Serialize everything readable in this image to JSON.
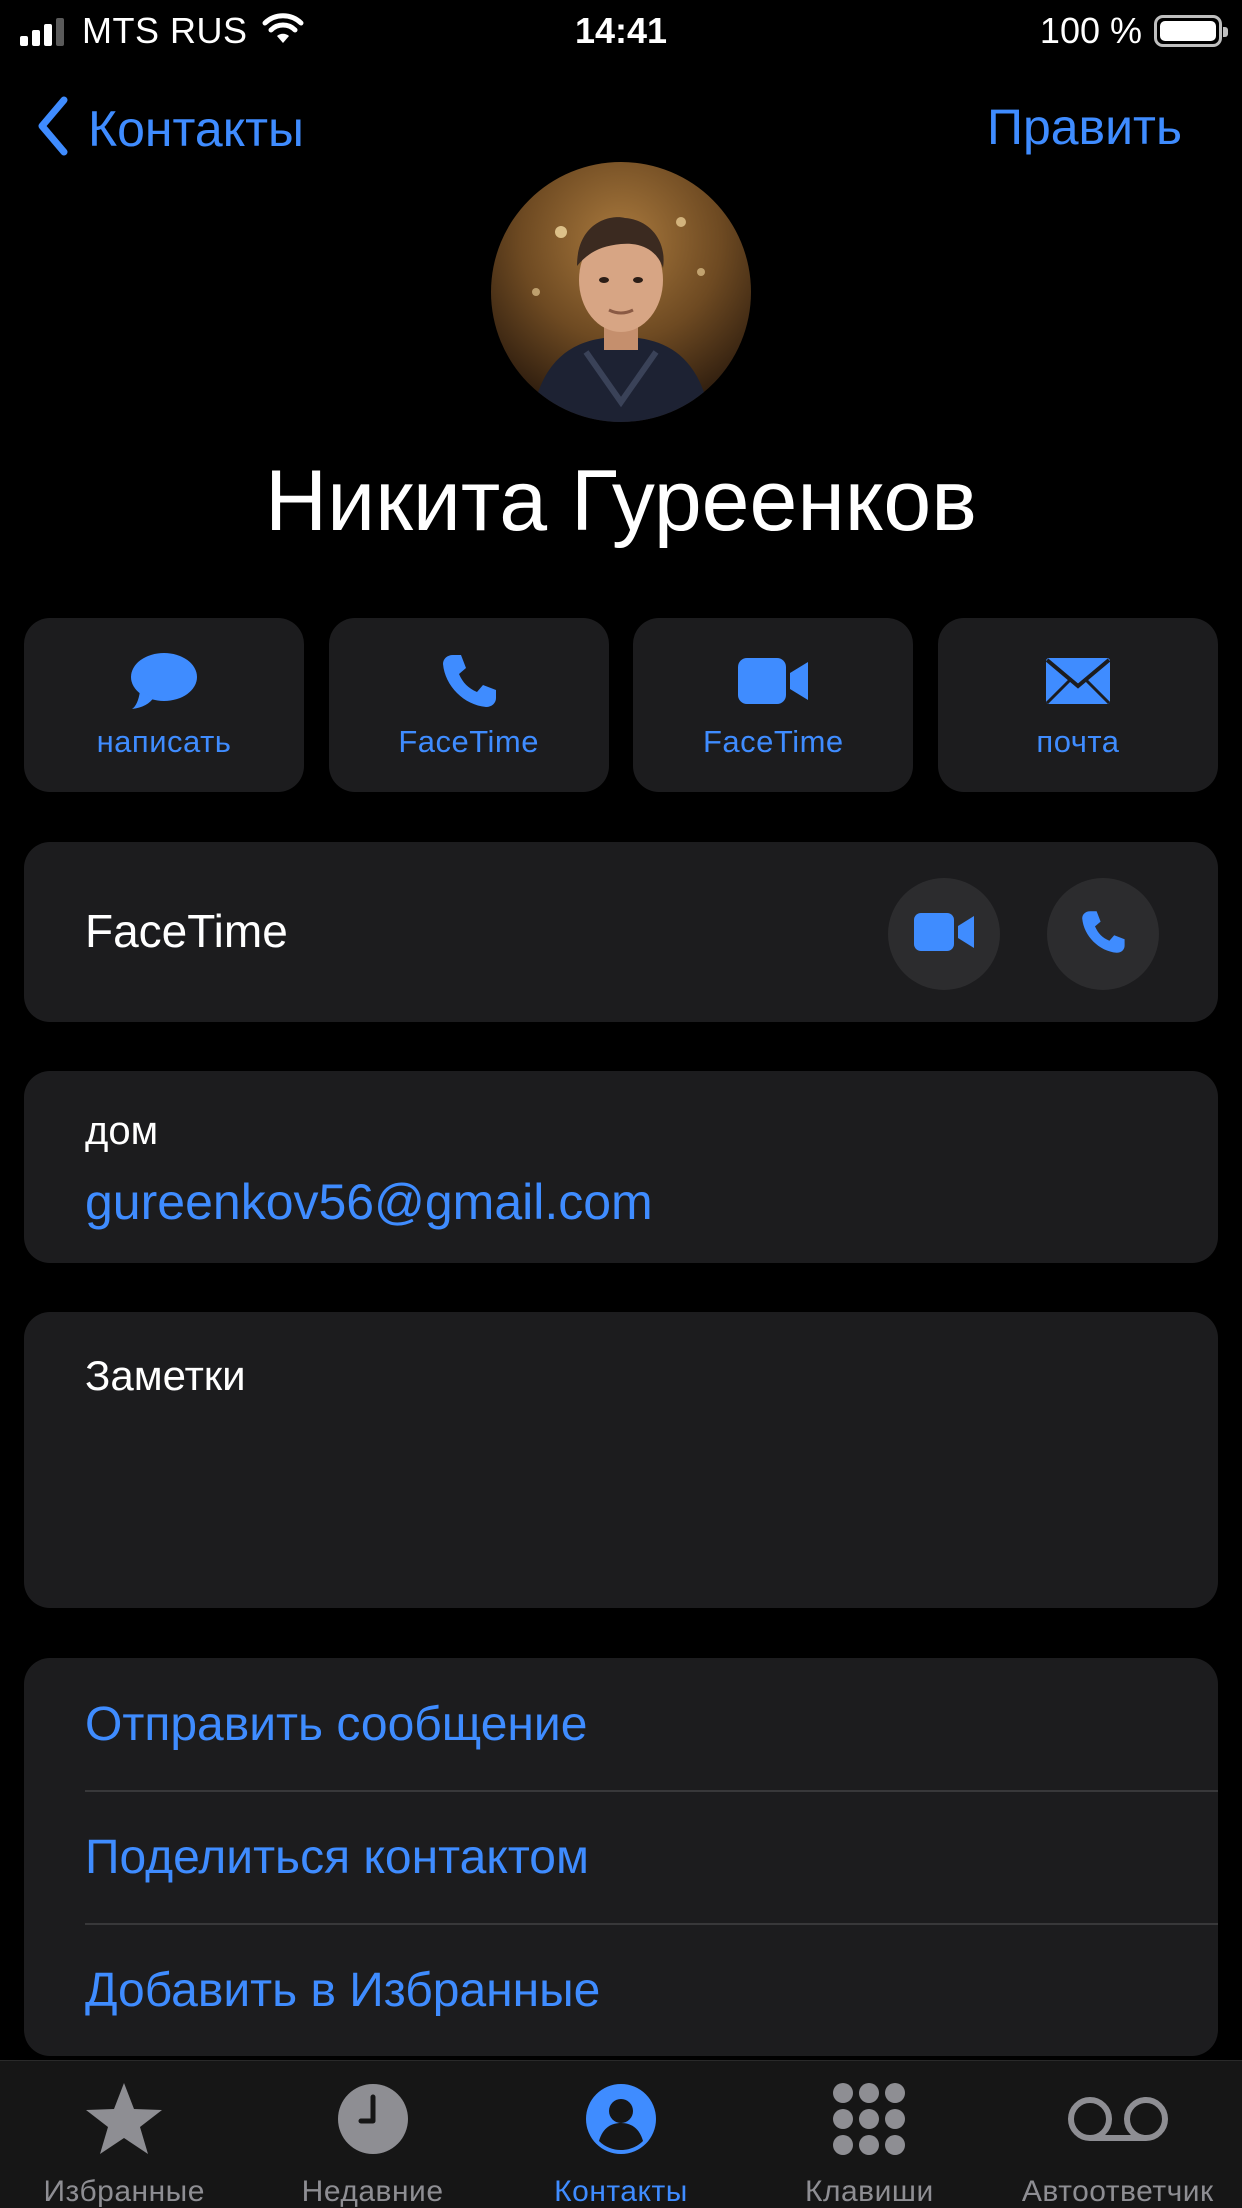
{
  "status_bar": {
    "carrier": "MTS RUS",
    "time": "14:41",
    "battery_percent": "100 %",
    "battery_level": 1.0,
    "signal_bars": 3,
    "signal_bars_total": 4
  },
  "nav": {
    "back_label": "Контакты",
    "edit_label": "Править"
  },
  "contact": {
    "name": "Никита Гуреенков"
  },
  "actions": [
    {
      "label": "написать",
      "icon": "message-bubble-icon"
    },
    {
      "label": "FaceTime",
      "icon": "phone-icon"
    },
    {
      "label": "FaceTime",
      "icon": "video-camera-icon"
    },
    {
      "label": "почта",
      "icon": "envelope-icon"
    }
  ],
  "facetime_row": {
    "label": "FaceTime"
  },
  "email": {
    "label": "дом",
    "value": "gureenkov56@gmail.com"
  },
  "notes": {
    "label": "Заметки"
  },
  "links": [
    {
      "label": "Отправить сообщение"
    },
    {
      "label": "Поделиться контактом"
    },
    {
      "label": "Добавить в Избранные"
    }
  ],
  "tab_bar": {
    "tabs": [
      {
        "label": "Избранные",
        "icon": "star-icon",
        "active": false
      },
      {
        "label": "Недавние",
        "icon": "clock-icon",
        "active": false
      },
      {
        "label": "Контакты",
        "icon": "person-circle-icon",
        "active": true
      },
      {
        "label": "Клавиши",
        "icon": "keypad-icon",
        "active": false
      },
      {
        "label": "Автоответчик",
        "icon": "voicemail-icon",
        "active": false
      }
    ]
  },
  "colors": {
    "accent": "#3f8cff",
    "background": "#000000",
    "card": "#1c1c1e",
    "inactive": "#8e8e93"
  }
}
